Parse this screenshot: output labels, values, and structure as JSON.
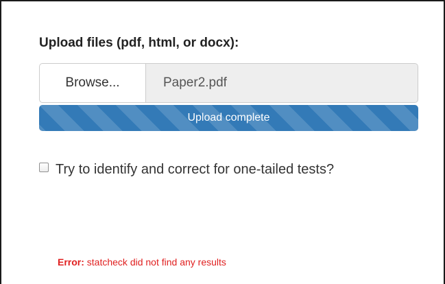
{
  "upload": {
    "label": "Upload files (pdf, html, or docx):",
    "browse_label": "Browse...",
    "file_name": "Paper2.pdf",
    "progress_text": "Upload complete",
    "progress_percent": 100
  },
  "options": {
    "one_tailed_label": "Try to identify and correct for one-tailed tests?",
    "one_tailed_checked": false
  },
  "error": {
    "prefix": "Error:",
    "message": "statcheck did not find any results"
  },
  "colors": {
    "progress_bar": "#337ab7",
    "error_text": "#e02020"
  }
}
